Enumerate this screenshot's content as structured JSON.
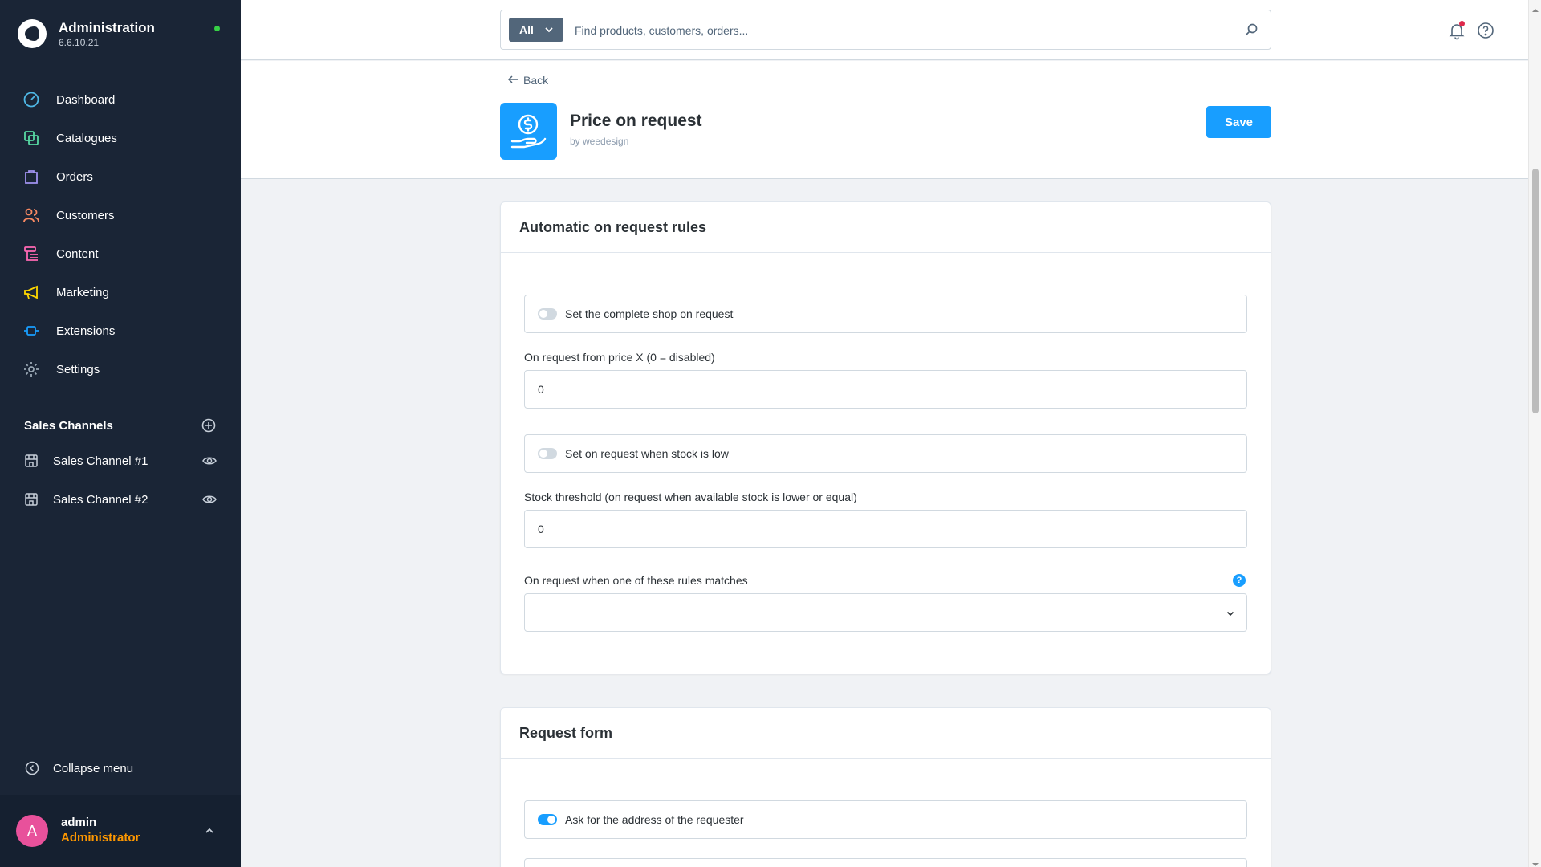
{
  "brand": {
    "title": "Administration",
    "version": "6.6.10.21",
    "status_color": "#37d046"
  },
  "nav": {
    "items": [
      {
        "label": "Dashboard",
        "icon": "dashboard-icon",
        "color": "#4fb8e6"
      },
      {
        "label": "Catalogues",
        "icon": "catalogues-icon",
        "color": "#57d9a3"
      },
      {
        "label": "Orders",
        "icon": "orders-icon",
        "color": "#a092f0"
      },
      {
        "label": "Customers",
        "icon": "customers-icon",
        "color": "#f88962"
      },
      {
        "label": "Content",
        "icon": "content-icon",
        "color": "#ff68b4"
      },
      {
        "label": "Marketing",
        "icon": "marketing-icon",
        "color": "#ffd700"
      },
      {
        "label": "Extensions",
        "icon": "extensions-icon",
        "color": "#189eff"
      },
      {
        "label": "Settings",
        "icon": "settings-icon",
        "color": "#9aa8b5"
      }
    ]
  },
  "sales_channels": {
    "title": "Sales Channels",
    "items": [
      {
        "label": "Sales Channel #1"
      },
      {
        "label": "Sales Channel #2"
      }
    ]
  },
  "collapse_label": "Collapse menu",
  "user": {
    "initial": "A",
    "name": "admin",
    "role": "Administrator"
  },
  "search": {
    "type_label": "All",
    "placeholder": "Find products, customers, orders..."
  },
  "header": {
    "back_label": "Back",
    "app_title": "Price on request",
    "vendor": "by weedesign",
    "save_label": "Save"
  },
  "cards": {
    "rules": {
      "title": "Automatic on request rules",
      "toggle_shop": {
        "label": "Set the complete shop on request",
        "on": false
      },
      "price_label": "On request from price X (0 = disabled)",
      "price_value": "0",
      "toggle_stock": {
        "label": "Set on request when stock is low",
        "on": false
      },
      "stock_label": "Stock threshold (on request when available stock is lower or equal)",
      "stock_value": "0",
      "rules_label": "On request when one of these rules matches",
      "help_symbol": "?"
    },
    "form": {
      "title": "Request form",
      "toggle_address": {
        "label": "Ask for the address of the requester",
        "on": true
      }
    }
  },
  "colors": {
    "accent": "#189eff",
    "sidebar": "#1a2536",
    "role": "#ff9800"
  }
}
